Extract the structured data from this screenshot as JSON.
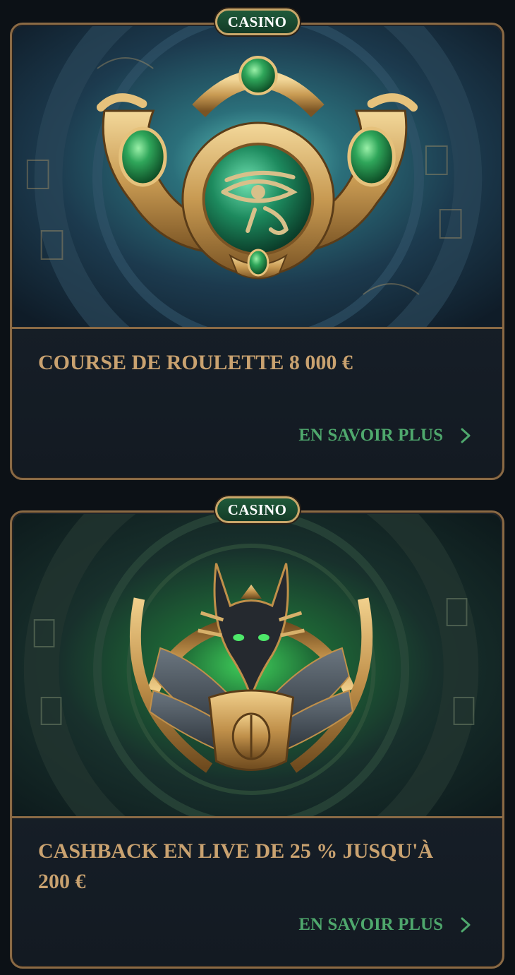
{
  "promotions": [
    {
      "badge": "CASINO",
      "title": "COURSE DE ROULETTE 8 000 €",
      "cta": "EN SAVOIR PLUS",
      "image_subject": "golden eye-of-horus amulet with green gems"
    },
    {
      "badge": "CASINO",
      "title": "CASHBACK EN LIVE DE 25 % JUSQU'À 200 €",
      "cta": "EN SAVOIR PLUS",
      "image_subject": "golden anubis head with winged scarab"
    }
  ],
  "colors": {
    "page_bg": "#0c1116",
    "card_border": "#8a6a45",
    "title_gold": "#c9a270",
    "cta_green": "#4fa86d",
    "badge_green": "#1f5a3a",
    "badge_border": "#c9a76a"
  },
  "icons": {
    "cta_arrow": "chevron-right-icon"
  }
}
